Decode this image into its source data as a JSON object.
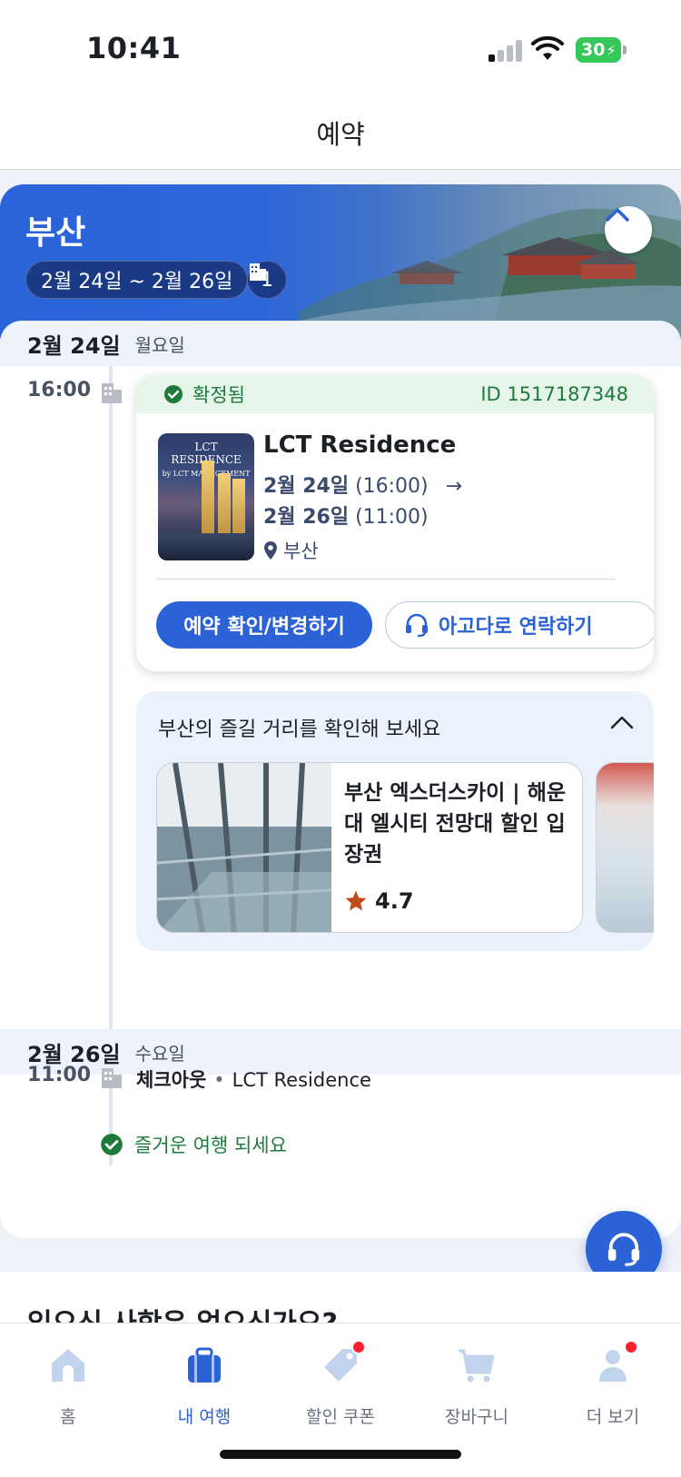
{
  "status_bar": {
    "time": "10:41",
    "battery": "30"
  },
  "header": {
    "title": "예약"
  },
  "trip": {
    "city": "부산",
    "date_range": "2월 24일 ~ 2월 26일",
    "property_count": "1"
  },
  "day1": {
    "date": "2월 24일",
    "weekday": "월요일",
    "time": "16:00",
    "booking": {
      "status": "확정됨",
      "booking_id": "ID 1517187348",
      "thumb_logo": "LCT RESIDENCE",
      "thumb_logo_sub": "by LCT MANAGEMENT",
      "hotel_name": "LCT Residence",
      "checkin_date": "2월 24일",
      "checkin_time": "(16:00)",
      "checkout_date": "2월 26일",
      "checkout_time": "(11:00)",
      "location": "부산",
      "primary_button": "예약 확인/변경하기",
      "contact_button": "아고다로 연락하기"
    },
    "activities": {
      "title": "부산의 즐길 거리를 확인해 보세요",
      "items": [
        {
          "title": "부산 엑스더스카이 | 해운대 엘시티 전망대 할인 입장권",
          "rating": "4.7"
        }
      ]
    }
  },
  "day2": {
    "date": "2월 26일",
    "weekday": "수요일",
    "time": "11:00",
    "event_label": "체크아웃",
    "event_property": "LCT Residence",
    "closing_message": "즐거운 여행 되세요"
  },
  "below_section": {
    "question": "잊으신 사항은 없으신가요?"
  },
  "tabbar": {
    "items": [
      {
        "label": "홈",
        "icon": "home-icon"
      },
      {
        "label": "내 여행",
        "icon": "suitcase-icon"
      },
      {
        "label": "할인 쿠폰",
        "icon": "tag-icon"
      },
      {
        "label": "장바구니",
        "icon": "cart-icon"
      },
      {
        "label": "더 보기",
        "icon": "person-icon"
      }
    ]
  },
  "colors": {
    "accent": "#2b63d6",
    "confirmed_green": "#1d7a3a",
    "badge_red": "#ff1e2d"
  }
}
